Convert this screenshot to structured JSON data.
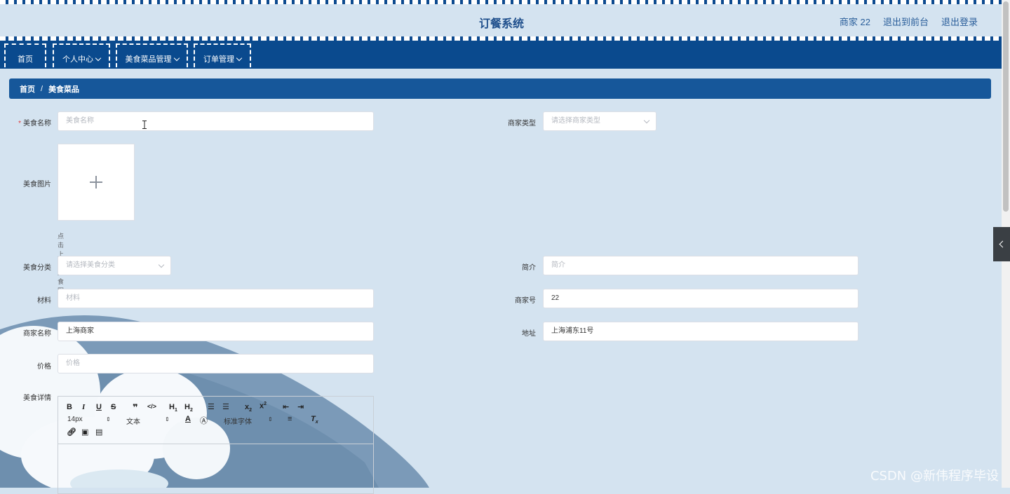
{
  "header": {
    "title": "订餐系统",
    "links": [
      "商家 22",
      "退出到前台",
      "退出登录"
    ]
  },
  "nav": {
    "items": [
      {
        "label": "首页",
        "has_dropdown": false
      },
      {
        "label": "个人中心",
        "has_dropdown": true
      },
      {
        "label": "美食菜品管理",
        "has_dropdown": true
      },
      {
        "label": "订单管理",
        "has_dropdown": true
      }
    ]
  },
  "breadcrumb": {
    "home": "首页",
    "separator": "/",
    "current": "美食菜品"
  },
  "form": {
    "food_name": {
      "label": "美食名称",
      "placeholder": "美食名称",
      "value": "",
      "required": true
    },
    "merchant_type": {
      "label": "商家类型",
      "placeholder": "请选择商家类型"
    },
    "food_image": {
      "label": "美食图片",
      "hint": "点击上传美食图片"
    },
    "food_category": {
      "label": "美食分类",
      "placeholder": "请选择美食分类"
    },
    "intro": {
      "label": "简介",
      "placeholder": "简介",
      "value": ""
    },
    "material": {
      "label": "材料",
      "placeholder": "材料",
      "value": ""
    },
    "merchant_no": {
      "label": "商家号",
      "value": "22"
    },
    "merchant_name": {
      "label": "商家名称",
      "value": "上海商家"
    },
    "address": {
      "label": "地址",
      "value": "上海浦东11号"
    },
    "price": {
      "label": "价格",
      "placeholder": "价格",
      "value": ""
    },
    "food_detail": {
      "label": "美食详情"
    }
  },
  "editor": {
    "font_size": "14px",
    "header_select": "文本",
    "font_family": "标准字体"
  },
  "watermark": "CSDN @新伟程序毕设",
  "colors": {
    "nav_bg": "#0a4a8e",
    "breadcrumb_bg": "#16579a",
    "page_bg": "#d4e3f0",
    "title": "#1f4f8c",
    "required": "#e23b3b"
  }
}
